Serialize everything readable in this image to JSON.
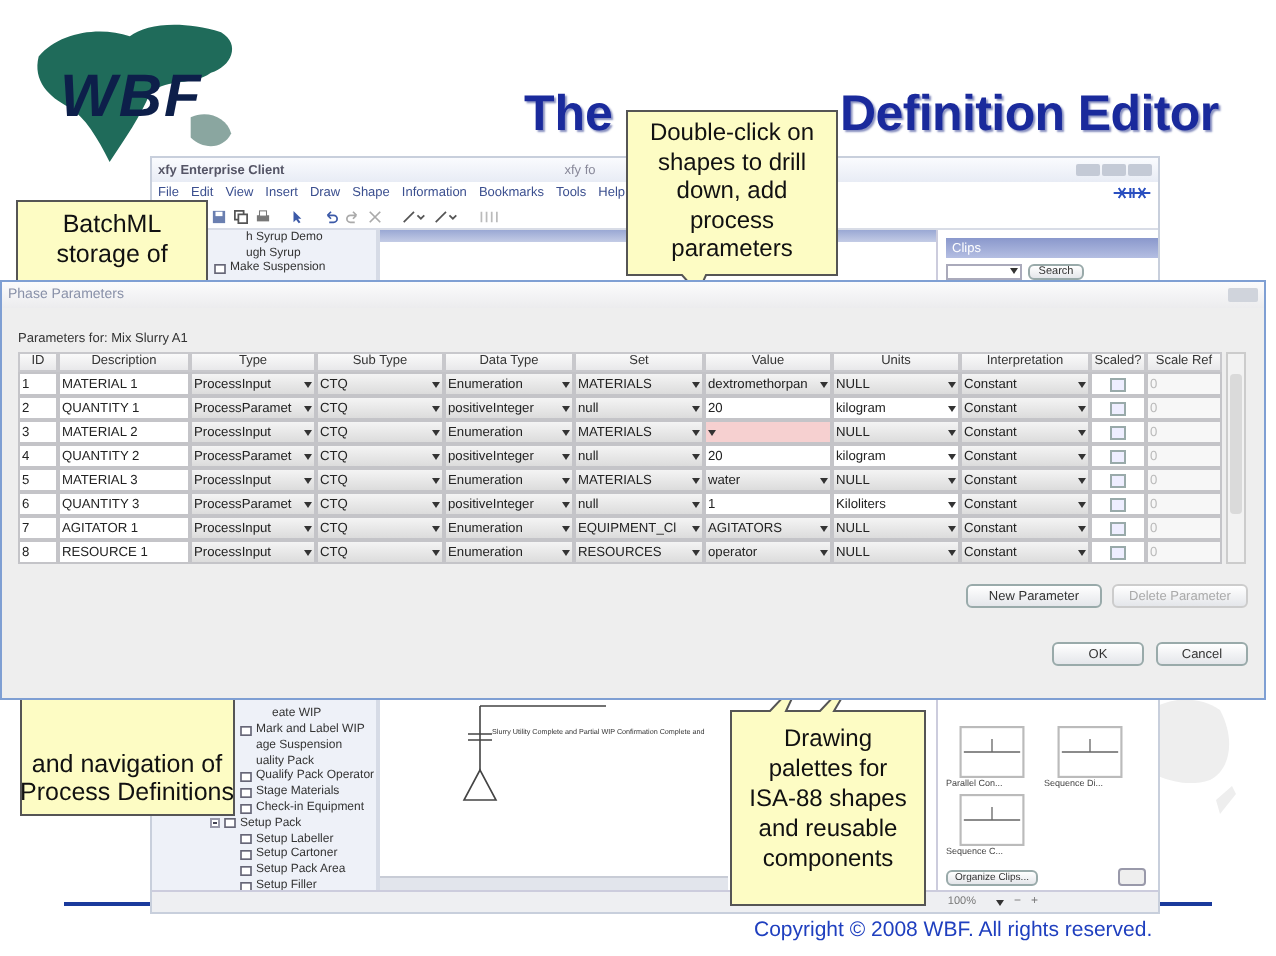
{
  "logo": {
    "text": "WBF"
  },
  "title": {
    "before": "The",
    "after": "Definition Editor"
  },
  "app_window": {
    "title": "xfy Enterprise Client",
    "title_center": "xfy fo",
    "menu": [
      "File",
      "Edit",
      "View",
      "Insert",
      "Draw",
      "Shape",
      "Information",
      "Bookmarks",
      "Tools",
      "Help"
    ],
    "tree_top": [
      {
        "label": "h Syrup Demo",
        "icon": false
      },
      {
        "label": "ugh Syrup",
        "icon": false
      },
      {
        "label": "Make Suspension"
      }
    ],
    "tree_bottom": [
      {
        "children": [
          {
            "label": "eate WIP",
            "icon": false
          },
          {
            "label": "Mark and Label WIP"
          }
        ]
      },
      {
        "label": "age Suspension",
        "icon": false
      },
      {
        "label": "uality Pack",
        "icon": false,
        "children": [
          {
            "label": "Qualify Pack Operator"
          },
          {
            "label": "Stage Materials"
          },
          {
            "label": "Check-in Equipment"
          }
        ]
      },
      {
        "label": "Setup Pack",
        "expanded": true,
        "children": [
          {
            "label": "Setup Labeller"
          },
          {
            "label": "Setup Cartoner"
          },
          {
            "label": "Setup Pack Area"
          },
          {
            "label": "Setup Filler"
          }
        ]
      }
    ],
    "canvas_label": "Slurry Utility Complete and Partial WIP Confirmation Complete and",
    "clips": {
      "title": "Clips",
      "search_button": "Search",
      "items": [
        "Parallel Con...",
        "Sequence Di...",
        "Sequence C..."
      ],
      "organize_button": "Organize Clips..."
    },
    "zoom": {
      "value": "100%",
      "zoom_out": "−",
      "zoom_in": "+"
    }
  },
  "notes": {
    "batchml": "BatchML storage of",
    "drill": "Double-click on shapes to drill down, add process parameters",
    "visual": "and navigation of Process Definitions",
    "palettes": "Drawing palettes for ISA-88 shapes and reusable components"
  },
  "dialog": {
    "title": "Phase Parameters",
    "caption": "Parameters for: Mix Slurry A1",
    "columns": [
      "ID",
      "Description",
      "Type",
      "Sub Type",
      "Data Type",
      "Set",
      "Value",
      "Units",
      "Interpretation",
      "Scaled?",
      "Scale Ref"
    ],
    "rows": [
      {
        "id": "1",
        "description": "MATERIAL 1",
        "type": "ProcessInput",
        "sub_type": "CTQ",
        "data_type": "Enumeration",
        "set": "MATERIALS",
        "value": {
          "kind": "dropdown",
          "text": "dextromethorpan"
        },
        "units": {
          "text": "NULL",
          "editable": false
        },
        "interpretation": "Constant",
        "scaled": false,
        "scale_ref": "0"
      },
      {
        "id": "2",
        "description": "QUANTITY 1",
        "type": "ProcessParamet",
        "sub_type": "CTQ",
        "data_type": "positiveInteger",
        "set": "null",
        "value": {
          "kind": "text",
          "text": "20"
        },
        "units": {
          "text": "kilogram",
          "editable": true
        },
        "interpretation": "Constant",
        "scaled": false,
        "scale_ref": "0"
      },
      {
        "id": "3",
        "description": "MATERIAL 2",
        "type": "ProcessInput",
        "sub_type": "CTQ",
        "data_type": "Enumeration",
        "set": "MATERIALS",
        "value": {
          "kind": "dropdown",
          "invalid": true
        },
        "units": {
          "text": "NULL",
          "editable": false
        },
        "interpretation": "Constant",
        "scaled": false,
        "scale_ref": "0"
      },
      {
        "id": "4",
        "description": "QUANTITY 2",
        "type": "ProcessParamet",
        "sub_type": "CTQ",
        "data_type": "positiveInteger",
        "set": "null",
        "value": {
          "kind": "text",
          "text": "20"
        },
        "units": {
          "text": "kilogram",
          "editable": true
        },
        "interpretation": "Constant",
        "scaled": false,
        "scale_ref": "0"
      },
      {
        "id": "5",
        "description": "MATERIAL 3",
        "type": "ProcessInput",
        "sub_type": "CTQ",
        "data_type": "Enumeration",
        "set": "MATERIALS",
        "value": {
          "kind": "dropdown",
          "text": "water"
        },
        "units": {
          "text": "NULL",
          "editable": false
        },
        "interpretation": "Constant",
        "scaled": false,
        "scale_ref": "0"
      },
      {
        "id": "6",
        "description": "QUANTITY 3",
        "type": "ProcessParamet",
        "sub_type": "CTQ",
        "data_type": "positiveInteger",
        "set": "null",
        "value": {
          "kind": "text",
          "text": "1"
        },
        "units": {
          "text": "Kiloliters",
          "editable": true
        },
        "interpretation": "Constant",
        "scaled": false,
        "scale_ref": "0"
      },
      {
        "id": "7",
        "description": "AGITATOR 1",
        "type": "ProcessInput",
        "sub_type": "CTQ",
        "data_type": "Enumeration",
        "set": "EQUIPMENT_Cl",
        "value": {
          "kind": "dropdown",
          "text": "AGITATORS"
        },
        "units": {
          "text": "NULL",
          "editable": false
        },
        "interpretation": "Constant",
        "scaled": false,
        "scale_ref": "0"
      },
      {
        "id": "8",
        "description": "RESOURCE 1",
        "type": "ProcessInput",
        "sub_type": "CTQ",
        "data_type": "Enumeration",
        "set": "RESOURCES",
        "value": {
          "kind": "dropdown",
          "text": "operator"
        },
        "units": {
          "text": "NULL",
          "editable": false
        },
        "interpretation": "Constant",
        "scaled": false,
        "scale_ref": "0"
      }
    ],
    "buttons": [
      {
        "label": "New Parameter",
        "disabled": false
      },
      {
        "label": "Delete Parameter",
        "disabled": true
      }
    ],
    "footer_buttons": [
      "OK",
      "Cancel"
    ]
  },
  "copyright": "Copyright © 2008 WBF. All rights reserved."
}
